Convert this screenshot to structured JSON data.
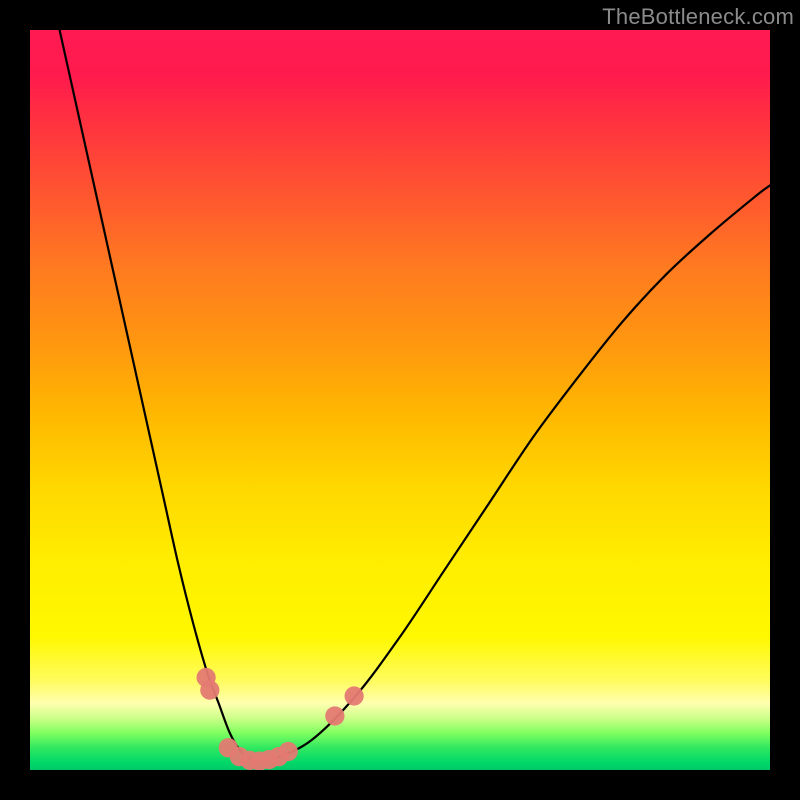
{
  "watermark": "TheBottleneck.com",
  "chart_data": {
    "type": "line",
    "title": "",
    "xlabel": "",
    "ylabel": "",
    "xlim": [
      0,
      100
    ],
    "ylim": [
      0,
      100
    ],
    "grid": false,
    "curve_color": "#000000",
    "marker_color": "#e47a72",
    "series": [
      {
        "name": "curve",
        "x": [
          4,
          6,
          8,
          10,
          12,
          14,
          16,
          18,
          20,
          22,
          24,
          25.5,
          27,
          28.5,
          30,
          31.5,
          33,
          38,
          44,
          50,
          56,
          62,
          68,
          74,
          80,
          86,
          92,
          98,
          100
        ],
        "y": [
          100,
          91,
          82,
          73,
          64,
          55,
          46,
          37,
          28,
          20,
          13,
          9,
          5,
          2.5,
          1.4,
          1.2,
          1.5,
          4,
          10,
          18,
          27,
          36,
          45,
          53,
          60.5,
          67,
          72.5,
          77.5,
          79
        ]
      }
    ],
    "markers": [
      {
        "x": 23.8,
        "y": 12.5,
        "r": 1.3
      },
      {
        "x": 24.3,
        "y": 10.8,
        "r": 1.3
      },
      {
        "x": 26.8,
        "y": 3.0,
        "r": 1.3
      },
      {
        "x": 28.3,
        "y": 1.8,
        "r": 1.3
      },
      {
        "x": 29.7,
        "y": 1.3,
        "r": 1.3
      },
      {
        "x": 31.0,
        "y": 1.2,
        "r": 1.3
      },
      {
        "x": 32.3,
        "y": 1.4,
        "r": 1.3
      },
      {
        "x": 33.6,
        "y": 1.8,
        "r": 1.3
      },
      {
        "x": 34.9,
        "y": 2.5,
        "r": 1.3
      },
      {
        "x": 41.2,
        "y": 7.3,
        "r": 1.3
      },
      {
        "x": 43.8,
        "y": 10.0,
        "r": 1.3
      }
    ],
    "gradient_bands_pct": [
      {
        "y": 0,
        "color": "#ff1a52"
      },
      {
        "y": 6,
        "color": "#ff1a4e"
      },
      {
        "y": 12,
        "color": "#ff3040"
      },
      {
        "y": 22,
        "color": "#ff5530"
      },
      {
        "y": 32,
        "color": "#ff7a20"
      },
      {
        "y": 42,
        "color": "#ff9610"
      },
      {
        "y": 52,
        "color": "#ffb800"
      },
      {
        "y": 62,
        "color": "#ffd800"
      },
      {
        "y": 72,
        "color": "#ffee00"
      },
      {
        "y": 82,
        "color": "#fff800"
      },
      {
        "y": 88,
        "color": "#fffc60"
      },
      {
        "y": 91,
        "color": "#ffffb0"
      },
      {
        "y": 93,
        "color": "#ccff88"
      },
      {
        "y": 95,
        "color": "#80ff60"
      },
      {
        "y": 97,
        "color": "#30e860"
      },
      {
        "y": 99,
        "color": "#00d868"
      },
      {
        "y": 100,
        "color": "#00c868"
      }
    ]
  }
}
